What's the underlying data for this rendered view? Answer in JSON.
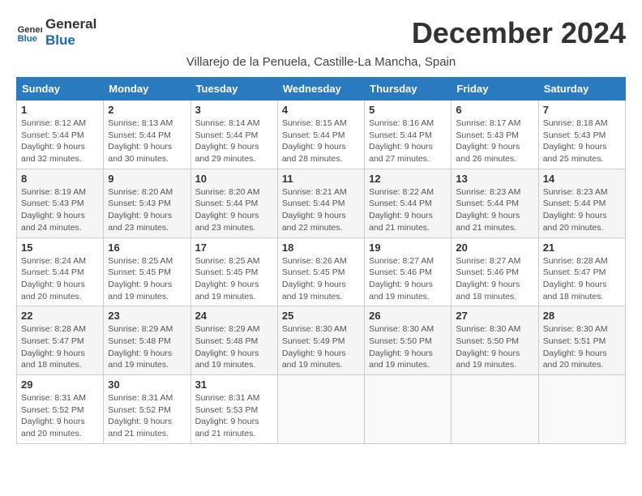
{
  "header": {
    "logo_line1": "General",
    "logo_line2": "Blue",
    "month_year": "December 2024",
    "location": "Villarejo de la Penuela, Castille-La Mancha, Spain"
  },
  "weekdays": [
    "Sunday",
    "Monday",
    "Tuesday",
    "Wednesday",
    "Thursday",
    "Friday",
    "Saturday"
  ],
  "weeks": [
    [
      {
        "day": "1",
        "sunrise": "Sunrise: 8:12 AM",
        "sunset": "Sunset: 5:44 PM",
        "daylight": "Daylight: 9 hours and 32 minutes."
      },
      {
        "day": "2",
        "sunrise": "Sunrise: 8:13 AM",
        "sunset": "Sunset: 5:44 PM",
        "daylight": "Daylight: 9 hours and 30 minutes."
      },
      {
        "day": "3",
        "sunrise": "Sunrise: 8:14 AM",
        "sunset": "Sunset: 5:44 PM",
        "daylight": "Daylight: 9 hours and 29 minutes."
      },
      {
        "day": "4",
        "sunrise": "Sunrise: 8:15 AM",
        "sunset": "Sunset: 5:44 PM",
        "daylight": "Daylight: 9 hours and 28 minutes."
      },
      {
        "day": "5",
        "sunrise": "Sunrise: 8:16 AM",
        "sunset": "Sunset: 5:44 PM",
        "daylight": "Daylight: 9 hours and 27 minutes."
      },
      {
        "day": "6",
        "sunrise": "Sunrise: 8:17 AM",
        "sunset": "Sunset: 5:43 PM",
        "daylight": "Daylight: 9 hours and 26 minutes."
      },
      {
        "day": "7",
        "sunrise": "Sunrise: 8:18 AM",
        "sunset": "Sunset: 5:43 PM",
        "daylight": "Daylight: 9 hours and 25 minutes."
      }
    ],
    [
      {
        "day": "8",
        "sunrise": "Sunrise: 8:19 AM",
        "sunset": "Sunset: 5:43 PM",
        "daylight": "Daylight: 9 hours and 24 minutes."
      },
      {
        "day": "9",
        "sunrise": "Sunrise: 8:20 AM",
        "sunset": "Sunset: 5:43 PM",
        "daylight": "Daylight: 9 hours and 23 minutes."
      },
      {
        "day": "10",
        "sunrise": "Sunrise: 8:20 AM",
        "sunset": "Sunset: 5:44 PM",
        "daylight": "Daylight: 9 hours and 23 minutes."
      },
      {
        "day": "11",
        "sunrise": "Sunrise: 8:21 AM",
        "sunset": "Sunset: 5:44 PM",
        "daylight": "Daylight: 9 hours and 22 minutes."
      },
      {
        "day": "12",
        "sunrise": "Sunrise: 8:22 AM",
        "sunset": "Sunset: 5:44 PM",
        "daylight": "Daylight: 9 hours and 21 minutes."
      },
      {
        "day": "13",
        "sunrise": "Sunrise: 8:23 AM",
        "sunset": "Sunset: 5:44 PM",
        "daylight": "Daylight: 9 hours and 21 minutes."
      },
      {
        "day": "14",
        "sunrise": "Sunrise: 8:23 AM",
        "sunset": "Sunset: 5:44 PM",
        "daylight": "Daylight: 9 hours and 20 minutes."
      }
    ],
    [
      {
        "day": "15",
        "sunrise": "Sunrise: 8:24 AM",
        "sunset": "Sunset: 5:44 PM",
        "daylight": "Daylight: 9 hours and 20 minutes."
      },
      {
        "day": "16",
        "sunrise": "Sunrise: 8:25 AM",
        "sunset": "Sunset: 5:45 PM",
        "daylight": "Daylight: 9 hours and 19 minutes."
      },
      {
        "day": "17",
        "sunrise": "Sunrise: 8:25 AM",
        "sunset": "Sunset: 5:45 PM",
        "daylight": "Daylight: 9 hours and 19 minutes."
      },
      {
        "day": "18",
        "sunrise": "Sunrise: 8:26 AM",
        "sunset": "Sunset: 5:45 PM",
        "daylight": "Daylight: 9 hours and 19 minutes."
      },
      {
        "day": "19",
        "sunrise": "Sunrise: 8:27 AM",
        "sunset": "Sunset: 5:46 PM",
        "daylight": "Daylight: 9 hours and 19 minutes."
      },
      {
        "day": "20",
        "sunrise": "Sunrise: 8:27 AM",
        "sunset": "Sunset: 5:46 PM",
        "daylight": "Daylight: 9 hours and 18 minutes."
      },
      {
        "day": "21",
        "sunrise": "Sunrise: 8:28 AM",
        "sunset": "Sunset: 5:47 PM",
        "daylight": "Daylight: 9 hours and 18 minutes."
      }
    ],
    [
      {
        "day": "22",
        "sunrise": "Sunrise: 8:28 AM",
        "sunset": "Sunset: 5:47 PM",
        "daylight": "Daylight: 9 hours and 18 minutes."
      },
      {
        "day": "23",
        "sunrise": "Sunrise: 8:29 AM",
        "sunset": "Sunset: 5:48 PM",
        "daylight": "Daylight: 9 hours and 19 minutes."
      },
      {
        "day": "24",
        "sunrise": "Sunrise: 8:29 AM",
        "sunset": "Sunset: 5:48 PM",
        "daylight": "Daylight: 9 hours and 19 minutes."
      },
      {
        "day": "25",
        "sunrise": "Sunrise: 8:30 AM",
        "sunset": "Sunset: 5:49 PM",
        "daylight": "Daylight: 9 hours and 19 minutes."
      },
      {
        "day": "26",
        "sunrise": "Sunrise: 8:30 AM",
        "sunset": "Sunset: 5:50 PM",
        "daylight": "Daylight: 9 hours and 19 minutes."
      },
      {
        "day": "27",
        "sunrise": "Sunrise: 8:30 AM",
        "sunset": "Sunset: 5:50 PM",
        "daylight": "Daylight: 9 hours and 19 minutes."
      },
      {
        "day": "28",
        "sunrise": "Sunrise: 8:30 AM",
        "sunset": "Sunset: 5:51 PM",
        "daylight": "Daylight: 9 hours and 20 minutes."
      }
    ],
    [
      {
        "day": "29",
        "sunrise": "Sunrise: 8:31 AM",
        "sunset": "Sunset: 5:52 PM",
        "daylight": "Daylight: 9 hours and 20 minutes."
      },
      {
        "day": "30",
        "sunrise": "Sunrise: 8:31 AM",
        "sunset": "Sunset: 5:52 PM",
        "daylight": "Daylight: 9 hours and 21 minutes."
      },
      {
        "day": "31",
        "sunrise": "Sunrise: 8:31 AM",
        "sunset": "Sunset: 5:53 PM",
        "daylight": "Daylight: 9 hours and 21 minutes."
      },
      {
        "day": "",
        "sunrise": "",
        "sunset": "",
        "daylight": ""
      },
      {
        "day": "",
        "sunrise": "",
        "sunset": "",
        "daylight": ""
      },
      {
        "day": "",
        "sunrise": "",
        "sunset": "",
        "daylight": ""
      },
      {
        "day": "",
        "sunrise": "",
        "sunset": "",
        "daylight": ""
      }
    ]
  ]
}
